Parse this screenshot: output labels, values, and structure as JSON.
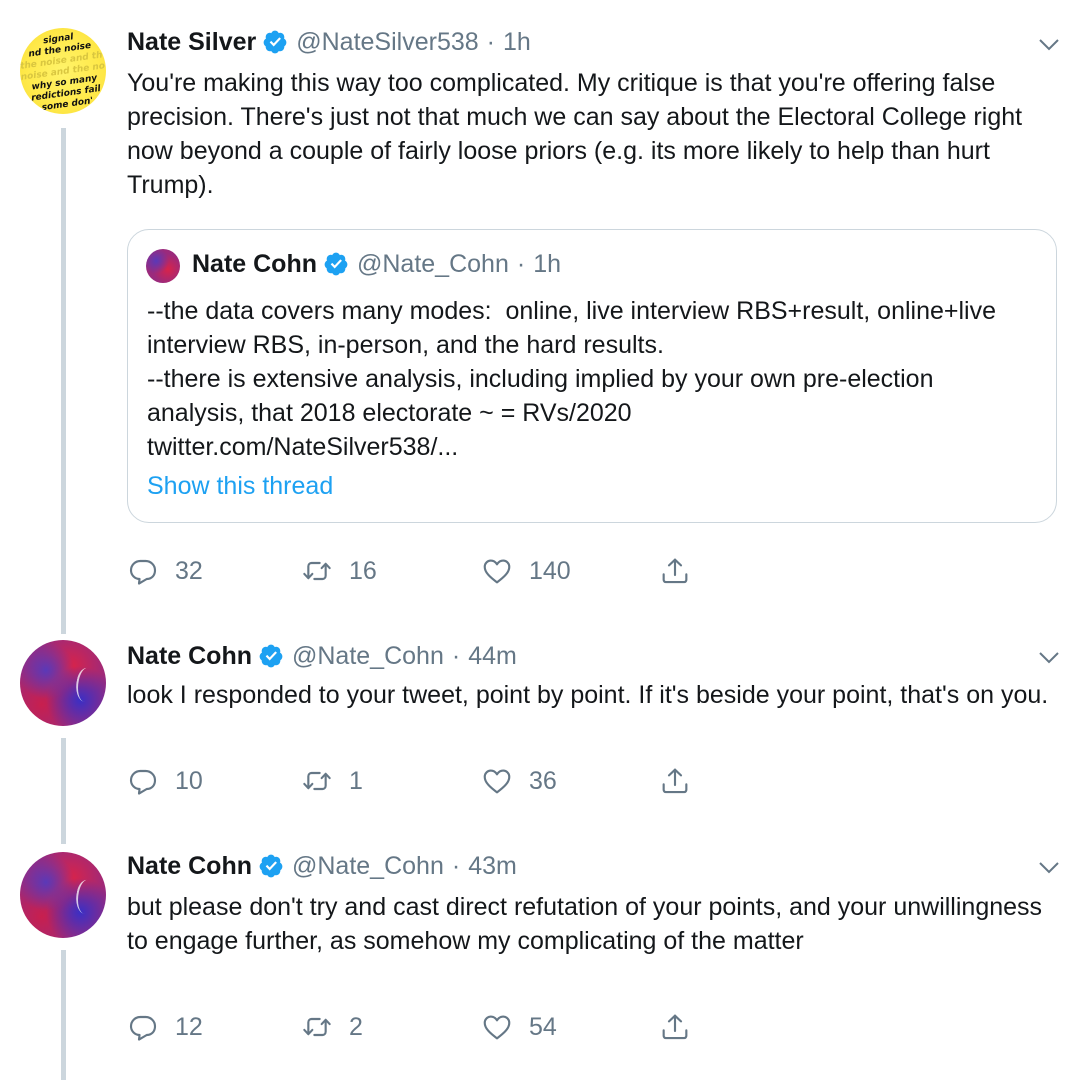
{
  "tweets": [
    {
      "name": "Nate Silver",
      "handle": "@NateSilver538",
      "time": "1h",
      "text": "You're making this way too complicated. My critique is that you're offering false precision. There's just not that much we can say about the Electoral College right now beyond a couple of fairly loose priors (e.g. its more likely to help than hurt Trump).",
      "avatar_text": [
        "signal",
        "nd the noise",
        "the noise and th",
        "noise and the no",
        "why so many",
        "redictions fail",
        "some don'"
      ],
      "quote": {
        "name": "Nate Cohn",
        "handle": "@Nate_Cohn",
        "time": "1h",
        "text": "--the data covers many modes:  online, live interview RBS+result, online+live interview RBS, in-person, and the hard results.\n--there is extensive analysis, including implied by your own pre-election analysis, that 2018 electorate ~ = RVs/2020\ntwitter.com/NateSilver538/...",
        "show_thread": "Show this thread"
      },
      "replies": "32",
      "retweets": "16",
      "likes": "140"
    },
    {
      "name": "Nate Cohn",
      "handle": "@Nate_Cohn",
      "time": "44m",
      "text": "look I responded to your tweet, point by point. If it's beside your point, that's on you.",
      "replies": "10",
      "retweets": "1",
      "likes": "36"
    },
    {
      "name": "Nate Cohn",
      "handle": "@Nate_Cohn",
      "time": "43m",
      "text": "but please don't try and cast direct refutation of your points, and your unwillingness to engage further, as somehow my complicating of the matter",
      "replies": "12",
      "retweets": "2",
      "likes": "54"
    }
  ],
  "separator": "·",
  "colors": {
    "accent": "#1da1f2",
    "secondary_text": "#657786",
    "thread_line": "#ccd6dd"
  },
  "icons": [
    "verified-badge-icon",
    "chevron-down-icon",
    "reply-icon",
    "retweet-icon",
    "like-icon",
    "share-icon"
  ]
}
